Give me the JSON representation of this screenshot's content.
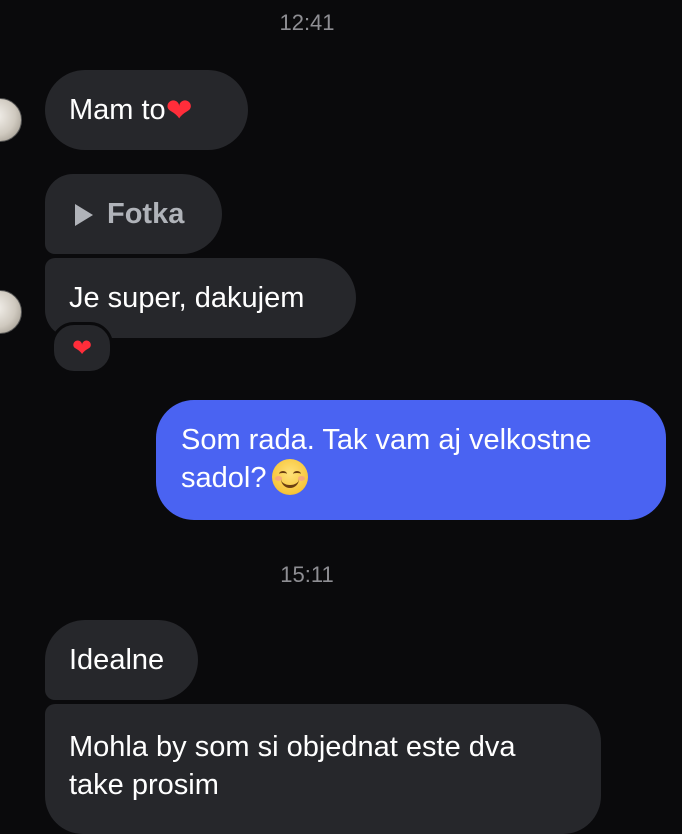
{
  "conversation": {
    "timestamps": [
      "12:41",
      "15:11"
    ],
    "messages": [
      {
        "id": "m1",
        "text": "Mam to",
        "emoji": "❤",
        "sender": "contact"
      },
      {
        "id": "m2",
        "text": "Fotka",
        "type": "photo-placeholder",
        "sender": "contact"
      },
      {
        "id": "m3",
        "text": "Je super, dakujem",
        "sender": "contact",
        "reaction": "❤"
      },
      {
        "id": "m4",
        "text_line1": "Som rada. Tak vam aj velkostne",
        "text_line2": "sadol?",
        "emoji": "smiling-face-icon",
        "sender": "me"
      },
      {
        "id": "m5",
        "text": "Idealne",
        "sender": "contact"
      },
      {
        "id": "m6",
        "text_line1": "Mohla by som si objednat este dva",
        "text_line2": "take prosim",
        "sender": "contact"
      }
    ]
  },
  "colors": {
    "background": "#0a0a0c",
    "incoming_bubble": "#26272b",
    "outgoing_bubble": "#4a63f2",
    "timestamp": "#8e8e93",
    "heart": "#ff2d3a"
  }
}
